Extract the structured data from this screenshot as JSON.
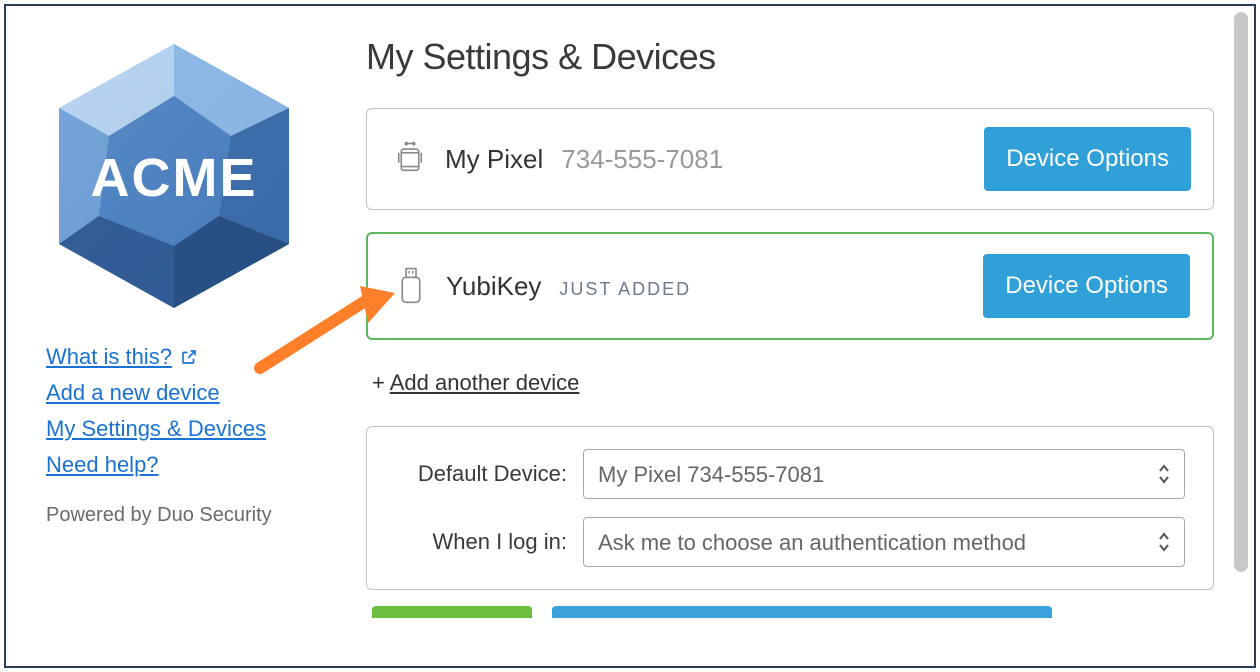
{
  "sidebar": {
    "logo_text": "ACME",
    "links": {
      "what_is_this": "What is this?",
      "add_device": "Add a new device",
      "settings_devices": "My Settings & Devices",
      "need_help": "Need help?"
    },
    "powered_by": "Powered by Duo Security"
  },
  "main": {
    "title": "My Settings & Devices",
    "devices": [
      {
        "name": "My Pixel",
        "sub": "734-555-7081",
        "badge": "",
        "options_label": "Device Options"
      },
      {
        "name": "YubiKey",
        "sub": "",
        "badge": "JUST ADDED",
        "options_label": "Device Options"
      }
    ],
    "add_another_label": "Add another device",
    "settings": {
      "default_device_label": "Default Device:",
      "default_device_value": "My Pixel 734-555-7081",
      "login_label": "When I log in:",
      "login_value": "Ask me to choose an authentication method"
    }
  },
  "colors": {
    "link_blue": "#1a73d4",
    "button_blue": "#30a0d8",
    "highlight_green": "#5cb85c",
    "arrow_orange": "#ff7f2a"
  }
}
